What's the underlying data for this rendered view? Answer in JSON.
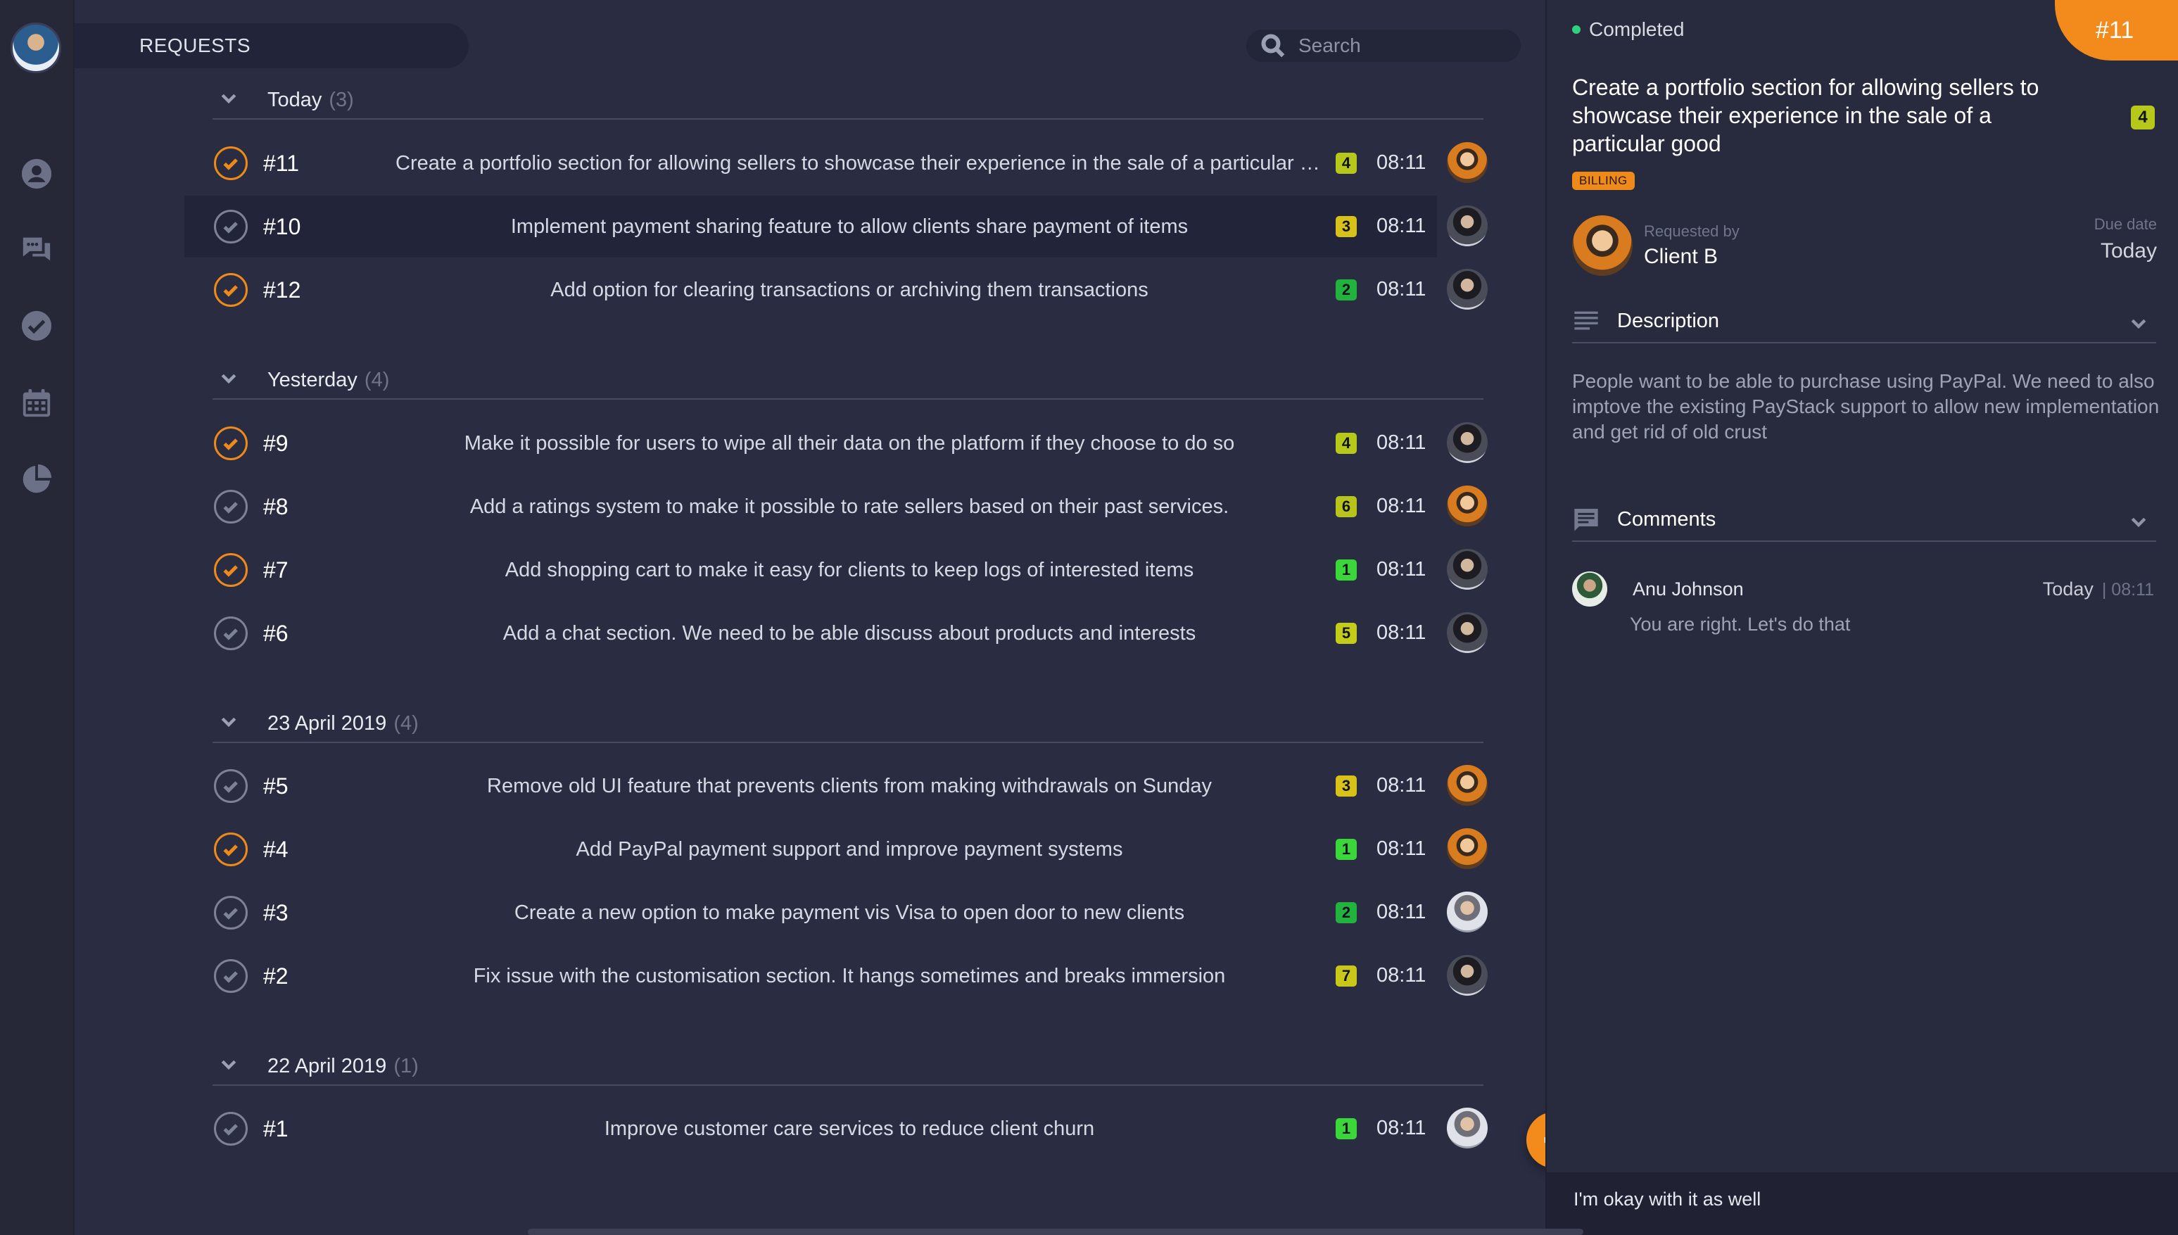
{
  "sidebar": {
    "icons": [
      "user-icon",
      "chat-icon",
      "check-circle-icon",
      "calendar-icon",
      "pie-chart-icon"
    ]
  },
  "header": {
    "title": "REQUESTS"
  },
  "search": {
    "placeholder": "Search"
  },
  "groups": [
    {
      "name": "Today",
      "count": "(3)"
    },
    {
      "name": "Yesterday",
      "count": "(4)"
    },
    {
      "name": "23 April 2019",
      "count": "(4)"
    },
    {
      "name": "22 April 2019",
      "count": "(1)"
    }
  ],
  "requests": [
    {
      "id": "#11",
      "title": "Create a portfolio section for allowing sellers to showcase their experience in the sale of a particular go...",
      "badge": "4",
      "badge_color": "#b6c81a",
      "time": "08:11",
      "status": "orange"
    },
    {
      "id": "#10",
      "title": "Implement payment sharing feature to allow clients share payment of items",
      "badge": "3",
      "badge_color": "#d8c21a",
      "time": "08:11",
      "status": "grey"
    },
    {
      "id": "#12",
      "title": "Add option for clearing transactions or archiving them transactions",
      "badge": "2",
      "badge_color": "#22b33f",
      "time": "08:11",
      "status": "orange"
    },
    {
      "id": "#9",
      "title": "Make it possible for users to wipe all their data on the platform if they choose to do so",
      "badge": "4",
      "badge_color": "#b6c81a",
      "time": "08:11",
      "status": "orange"
    },
    {
      "id": "#8",
      "title": "Add a ratings system to make it possible to rate sellers based on their past services.",
      "badge": "6",
      "badge_color": "#b9c41a",
      "time": "08:11",
      "status": "grey"
    },
    {
      "id": "#7",
      "title": "Add shopping cart to make it easy for clients to keep logs of interested items",
      "badge": "1",
      "badge_color": "#3ad63a",
      "time": "08:11",
      "status": "orange"
    },
    {
      "id": "#6",
      "title": "Add a chat section. We need to be able discuss about products and interests",
      "badge": "5",
      "badge_color": "#c4cc1a",
      "time": "08:11",
      "status": "grey"
    },
    {
      "id": "#5",
      "title": "Remove old UI feature that prevents clients from making withdrawals on Sunday",
      "badge": "3",
      "badge_color": "#d8c21a",
      "time": "08:11",
      "status": "grey"
    },
    {
      "id": "#4",
      "title": "Add PayPal payment support and improve payment systems",
      "badge": "1",
      "badge_color": "#3ad63a",
      "time": "08:11",
      "status": "orange"
    },
    {
      "id": "#3",
      "title": "Create a new option to make payment vis Visa to open door to new clients",
      "badge": "2",
      "badge_color": "#22b33f",
      "time": "08:11",
      "status": "grey"
    },
    {
      "id": "#2",
      "title": "Fix issue with the customisation section. It hangs sometimes and breaks immersion",
      "badge": "7",
      "badge_color": "#c9c81a",
      "time": "08:11",
      "status": "grey"
    },
    {
      "id": "#1",
      "title": "Improve customer care services to reduce client churn",
      "badge": "1",
      "badge_color": "#3ad63a",
      "time": "08:11",
      "status": "grey"
    }
  ],
  "detail": {
    "status": "Completed",
    "id": "#11",
    "title": "Create a portfolio section for allowing sellers to showcase their experience in the sale of a particular good",
    "badge": "4",
    "tag": "BILLING",
    "requested_by_label": "Requested by",
    "requested_by": "Client B",
    "due_label": "Due date",
    "due_value": "Today",
    "description_title": "Description",
    "description": "People want to be able to purchase using PayPal. We need to also imptove the existing PayStack support to allow new implementation and get rid of old crust",
    "comments_title": "Comments",
    "comment": {
      "author": "Anu Johnson",
      "day": "Today",
      "time": "| 08:11",
      "text": "You are right. Let's do that"
    },
    "reply": "I'm okay with it as well"
  },
  "colors": {
    "accent": "#f28b1c",
    "status_dot": "#2fd27a",
    "panel_bg": "#2a2d42"
  }
}
